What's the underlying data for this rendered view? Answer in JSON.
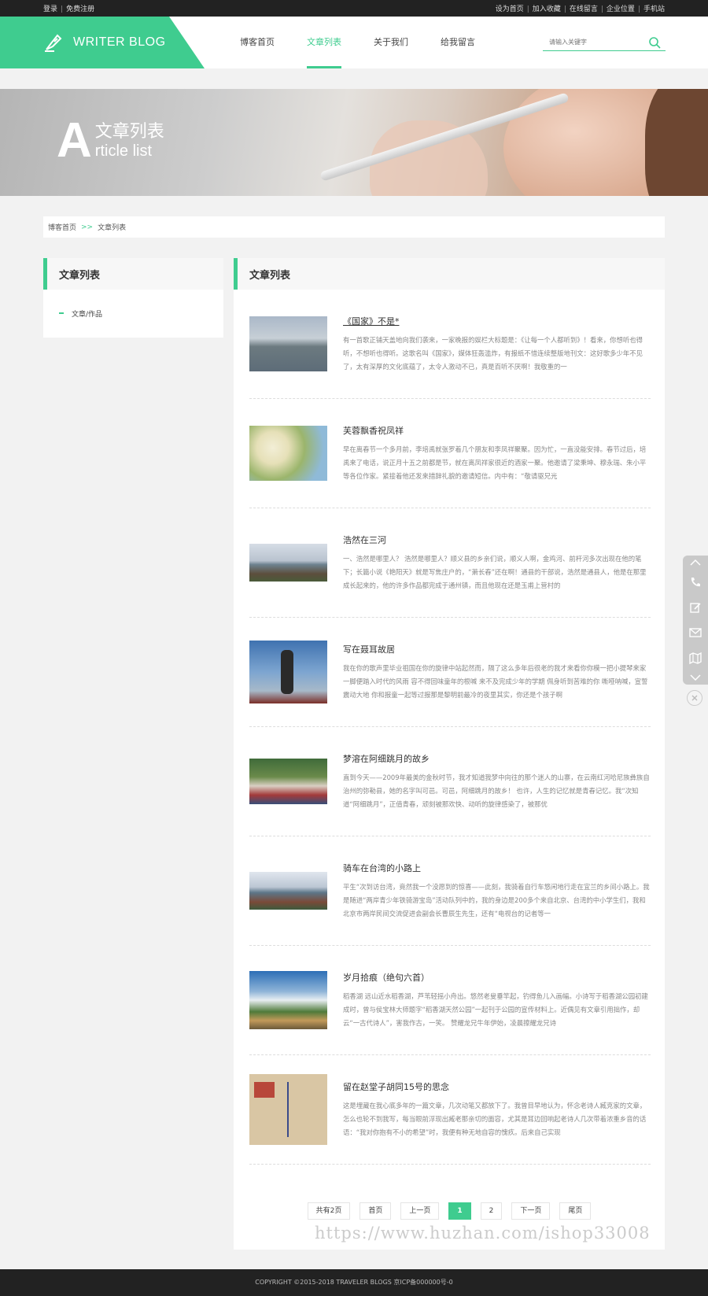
{
  "topbar": {
    "left": [
      "登录",
      "免费注册"
    ],
    "right": [
      "设为首页",
      "加入收藏",
      "在线留言",
      "企业位置",
      "手机站"
    ]
  },
  "logo": {
    "text": "WRITER BLOG"
  },
  "nav": [
    "博客首页",
    "文章列表",
    "关于我们",
    "给我留言"
  ],
  "nav_active": 1,
  "search": {
    "placeholder": "请输入关键字"
  },
  "banner": {
    "big_letter": "A",
    "title_zh": "文章列表",
    "title_en": "rticle list"
  },
  "breadcrumb": {
    "home": "博客首页",
    "separator": ">>",
    "current": "文章列表"
  },
  "sidebar": {
    "title": "文章列表",
    "items": [
      "文章/作品"
    ]
  },
  "main": {
    "title": "文章列表",
    "articles": [
      {
        "title": "《国家》不是*",
        "summary": "有一首歌正铺天盖地向我们袭来，一家晚报的娱栏大标题是：《让每一个人都听到》！看来，你想听也得听，不想听也得听。这歌名叫《国家》，媒体狂轰滥炸，有报纸不惜连续整版地刊文：这好歌多少年不见了，太有深厚的文化底蕴了，太令人激动不已，真是百听不厌啊！我敬重的一",
        "thumb": "lake"
      },
      {
        "title": "芙蓉飘香祝凤祥",
        "summary": "早在离春节一个多月前，李培禹就张罗着几个朋友和李凤祥聚聚。因为忙，一直没能安排。春节过后，培禹来了电话，说正月十五之前都是节，就在离凤祥家很近的酒家一聚。他邀请了梁秉坤、穆永瑞、朱小平等各位作家。紧接着他还发来措辞礼貌的邀请短信。内中有：“敬请驱兄光",
        "thumb": "flowers"
      },
      {
        "title": "浩然在三河",
        "summary": "一、浩然是哪里人？ 浩然是哪里人？顺义县的乡亲们说，顺义人啊，金鸡河、前杆河多次出现在他的笔下；长篇小说《艳阳天》就是写焦庄户的，“萧长春”还在啊！通县的干部说，浩然是通县人，他是在那里成长起来的，他的许多作品都完成于通州镇，而且他现在还是玉甫上营村的",
        "thumb": "coast"
      },
      {
        "title": "写在聂耳故居",
        "summary": "我在你的歌声里毕业祖国在你的旋律中站起然而，隔了这么多年后很老的我才来看你你模一把小提琴来家一脚便踏入时代的风雨 容不得回味童年的根喊 来不及完成少年的学期 佩身听到苦难的你 嘶哑呐喊，宣誓震动大地 你和报童一起等过报那是黎明前最冷的夜里其实，你还是个孩子啊",
        "thumb": "statue"
      },
      {
        "title": "梦溶在阿细跳月的故乡",
        "summary": "直到今天——2009年最美的金秋时节，我才知道我梦中向往的那个迷人的山寨，在云南红河哈尼族彝族自治州的弥勒县，她的名字叫可邑。可邑，阿细跳月的故乡！ 也许，人生的记忆就是青春记忆。我“次知道“阿细跳月”，正值青春，顽刻被那欢快、动听的旋律感染了，被那优",
        "thumb": "people"
      },
      {
        "title": "骑车在台湾的小路上",
        "summary": "平生“次到访台湾，竟然我一个没愿到的惊喜——此刻，我骑着自行车悠闲地行走在宜兰的乡间小路上。我是随进“两岸青少年铁骑游宝岛”活动队列中的，我的身边是200多个来自北京、台湾的中小学生们，我和北京市两岸民间交流促进会副会长曹辰生先生，还有“电视台的记者等一",
        "thumb": "coast2"
      },
      {
        "title": "岁月拾痕（绝句六首）",
        "summary": "稻香湖 远山近水稻香湖，芦苇轻摇小舟出。悠然老叟垂竿起，钓得鱼儿入画幅。小诗写于稻香湖公园初建成时，曾与侯宝林大师题字“稻香湖天然公园”一起刊于公园的宣传材料上。近偶见有文章引用拙作，却云“一古代诗人”，害我作古，一笑。 赞耀龙兄牛年伊始，凌晨擦耀龙兄诗",
        "thumb": "landscape"
      },
      {
        "title": "留在赵堂子胡同15号的思念",
        "summary": "这是埋藏在我心底多年的一篇文章，几次动笔又都放下了。我曾目早地认为，怀念老诗人臧克家的文章，怎么也轮不到我写，每当眼前浮现出臧老那亲切的面容，尤其是耳边回响起老诗人几次带着浓重乡音的话语：“我对你抱有不小的希望”时，我便有种无地自容的愧疚。后来自己实现",
        "thumb": "letter"
      }
    ]
  },
  "pagination": [
    "共有2页",
    "首页",
    "上一页",
    "1",
    "2",
    "下一页",
    "尾页"
  ],
  "pagination_active": 3,
  "footer": {
    "copyright": "COPYRIGHT ©2015-2018 TRAVELER BLOGS 京ICP备000000号-0"
  },
  "watermark": "https://www.huzhan.com/ishop33008",
  "float_toolbar": [
    "chevron-up-icon",
    "phone-icon",
    "edit-icon",
    "mail-icon",
    "map-icon",
    "chevron-down-icon"
  ],
  "accent_color": "#3fcc8f"
}
